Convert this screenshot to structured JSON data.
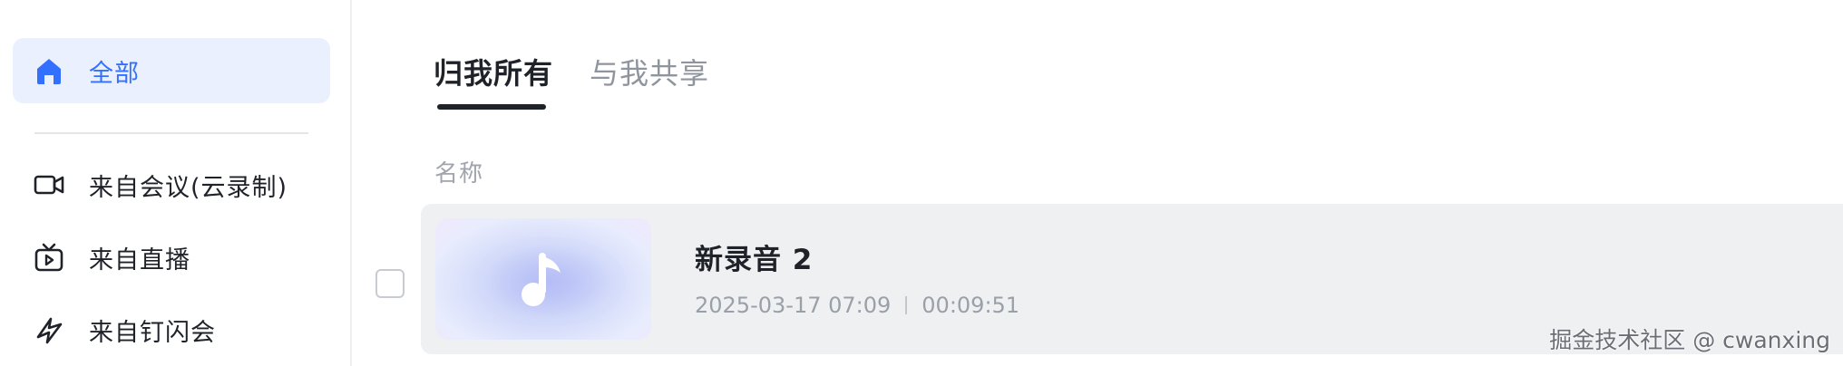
{
  "sidebar": {
    "items": [
      {
        "label": "全部",
        "icon": "home-icon",
        "active": true
      },
      {
        "label": "来自会议(云录制)",
        "icon": "video-camera-icon"
      },
      {
        "label": "来自直播",
        "icon": "tv-icon"
      },
      {
        "label": "来自钉闪会",
        "icon": "flash-meeting-icon"
      }
    ]
  },
  "tabs": {
    "active": "归我所有",
    "inactive": "与我共享"
  },
  "list": {
    "column_name": "名称",
    "rows": [
      {
        "name": "新录音 2",
        "datetime": "2025-03-17 07:09",
        "duration": "00:09:51",
        "thumbnail_icon": "music-note-icon"
      }
    ]
  },
  "watermark": "掘金技术社区 @ cwanxing",
  "colors": {
    "accent": "#3370ff",
    "row_bg": "#eff0f2",
    "active_bg": "#eaf0fd"
  }
}
